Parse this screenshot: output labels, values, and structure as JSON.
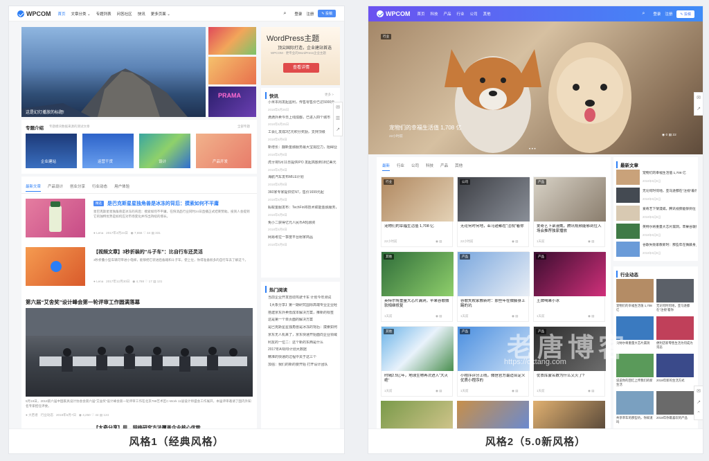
{
  "style1": {
    "caption": "风格1（经典风格）",
    "brand": "WPCOM",
    "nav": [
      "首页",
      "文章分类 ⌄",
      "专题列表",
      "问答社区",
      "快讯",
      "更多页面 ⌄"
    ],
    "login": "登录",
    "register": "注册",
    "post": "投稿",
    "slider_caption": "这是幻灯播放的标题!",
    "ad_title": "WordPress主题",
    "ad_sub": "顶尖国际打造，企业建站首选",
    "ad_desc": "WPCOM · 更专业的WordPress企业主题",
    "ad_btn": "查看详情",
    "thumb_tags": [
      "",
      "",
      "PRAMA"
    ],
    "topics_title": "专题介绍",
    "topics_sub": "专题模块数据来源的测试文章",
    "topics_more": "全部专题",
    "topics": [
      "企业建站",
      "运营干货",
      "设计",
      "产品开发"
    ],
    "tabs": [
      "最新文章",
      "产品设计",
      "创业分享",
      "行业动态",
      "用户体验"
    ],
    "post1": {
      "tag": "精选",
      "title": "是巴克斯星星独角兽是冰冻的背后：摸索如何不平庸",
      "excerpt": "星巴克斯星星独角兽是冰冻的背后：摸索如何不平庸，在快消品行业同时24日直播正式结束赞助。投资人会提到它的独特优势是如何应对市场变化并作出持续的增长。",
      "author": "Lena",
      "date": "2017年4月24日",
      "views": "7,656",
      "likes": "44",
      "comments": "331"
    },
    "post2": {
      "tag": "精选",
      "title": "【视频文章】3秒折装的“斗子车”：比自行车还灵活",
      "excerpt": "3秒折叠小型车辆可带进小电梯，能够把它装进后备箱和斗子车，使上位，你得准备很多的自行车去了解这个。",
      "author": "Lena",
      "date": "2017年12月30日",
      "views": "4,788",
      "likes": "17",
      "comments": "131"
    },
    "feature": {
      "title": "第六届“艾舍奖”设计峰会第一轮评审工作圆满落幕",
      "excerpt": "5月19日，2018第六届中国家具设计协会会第六届“艾舍奖”设计峰会第一轮评审工作在北京798艺术区C-Work 11层设计师盛会工作展开，本届评审邀请了国内外知名专家担任评委。",
      "author": "大若者",
      "cat": "行业动态",
      "date": "2018年5月7日",
      "views": "4,250",
      "likes": "44",
      "comments": "124"
    },
    "post3": {
      "title": "【大奇分享】用... 网络研究方法覆盖企业核心优势"
    },
    "news_title": "快讯",
    "news_more": "更多 >",
    "news": [
      [
        "小米本周发起盈利，传售零售价已达5000元，售价为200亿美元",
        "2018年6月26日"
      ],
      [
        "滴滴外卖今日上线成都，已进入四个城市",
        "2018年6月25日"
      ],
      [
        "工会汇发成2亿元积分奖励，支持顶级",
        "2018年6月8日"
      ],
      [
        "新增长：翻新金融服务最大宝需应力，阻碍业绩表现",
        "2018年6月8日"
      ],
      [
        "虎牙将5月11日提供IPO 发起高额到18亿美元",
        "2018年6月8日"
      ],
      [
        "海航汽车发布MILE计划",
        "2018年6月8日"
      ],
      [
        "360家专家提供优N7，售价1699元起",
        "2018年6月8日"
      ],
      [
        "蚂蚁金服发布：TechFin将技术赋能金融服务，按照省权益未来方向",
        "2018年6月8日"
      ],
      [
        "免小二获得亿元人民币A轮融资",
        "2018年6月8日"
      ],
      [
        "网易考拉一季度平台射家商品",
        "2018年6月8日"
      ]
    ],
    "hot_title": "热门阅读",
    "hot": [
      "当前企业开发自动驾驶卡车 计划今年测试",
      "【大象分享】第一期研究国际高端专业企业经验",
      "搭建京东外卖低成本解决方案，推新的标签",
      "这是第一个单页面的解决方案",
      "是巴克斯星星独角兽是冰冻的背后：摸索如何不平庸",
      "京东无人机来了，京东快递开始面向企业领域，未来逐步将开启",
      "利友的一位二：这个新的东西是什么",
      "2017年AI领导计划大数据",
      "精准的快递的过程中关于这三个",
      "加强：我们的新的要开始 打开设计团队"
    ]
  },
  "style2": {
    "caption": "风格2（5.0新风格）",
    "brand": "WPCOM",
    "nav": [
      "首页",
      "科技",
      "产品",
      "行业",
      "公司",
      "其他"
    ],
    "login": "登录",
    "register": "注册",
    "post": "投稿",
    "hero_tag": "行业",
    "hero_title": "宠物们的幸福生活值 1,708 亿",
    "hero_time": "22小时前",
    "hero_likes": "0",
    "hero_comments": "22",
    "tabs": [
      "最新",
      "行业",
      "公司",
      "科技",
      "产品",
      "其他"
    ],
    "cards": [
      {
        "tag": "行业",
        "title": "宠物们的幸福生活值 1,708 亿",
        "meta": "22小时前"
      },
      {
        "tag": "公司",
        "title": "无论何时何地，亚马逊都在“注视”着你",
        "meta": "22小时前"
      },
      {
        "tag": "产品",
        "title": "爱奇艺下架漫威，腾讯视频能够到位入场会推荐独家播放",
        "meta": "1天前"
      },
      {
        "tag": "其他",
        "title": "英特尔将重量大芯片漏洞，苹果谷歌微软相继修复",
        "meta": "1天前"
      },
      {
        "tag": "产品",
        "title": "谷歌失败家教新时：那些年在微藤身上踢的坑",
        "meta": "1天前"
      },
      {
        "tag": "产品",
        "title": "王牌喝果小冰",
        "meta": "1天前"
      },
      {
        "tag": "其他",
        "title": "时隔2.5亿年，地球生物再次进入“大灭绝”",
        "meta": "1天前"
      },
      {
        "tag": "产品",
        "title": "小程序评分上线，微信官方最适合定义优质小程序的",
        "meta": "1天前"
      },
      {
        "tag": "产品",
        "title": "优衣库蒙名数为什么又火了?",
        "meta": "1天前"
      }
    ],
    "recent_title": "最新文章",
    "recent": [
      [
        "宠物们的幸福生活值 1,708 亿",
        "2018年6月6日"
      ],
      [
        "无论何时何地，亚马逊都在“注视”着你",
        "2018年6月6日"
      ],
      [
        "爱奇艺下架漫威，腾讯视频能够到位",
        "2018年6月6日"
      ],
      [
        "英特尔将重量大芯片漏洞，苹果谷歌微软修复",
        "2018年6月6日"
      ],
      [
        "谷歌失败家教新时：那些年在微藤身上",
        "2018年6月6日"
      ]
    ],
    "industry_title": "行业动态",
    "industry": [
      "宠物们的幸福生活值 1,708 亿",
      "无论何时何地，亚马逊都在“注视”着你",
      "英特尔将重量大芯片漏洞",
      "便利店新零售生活为何成为常态",
      "说说你的回忆上传我们的新生活",
      "2018年新的生活方式",
      "共享单车的那些坑，你知道吗",
      "2018年你最喜欢的产品"
    ],
    "watermark": "老唐博客",
    "watermark_url": "https://oktang.com"
  }
}
